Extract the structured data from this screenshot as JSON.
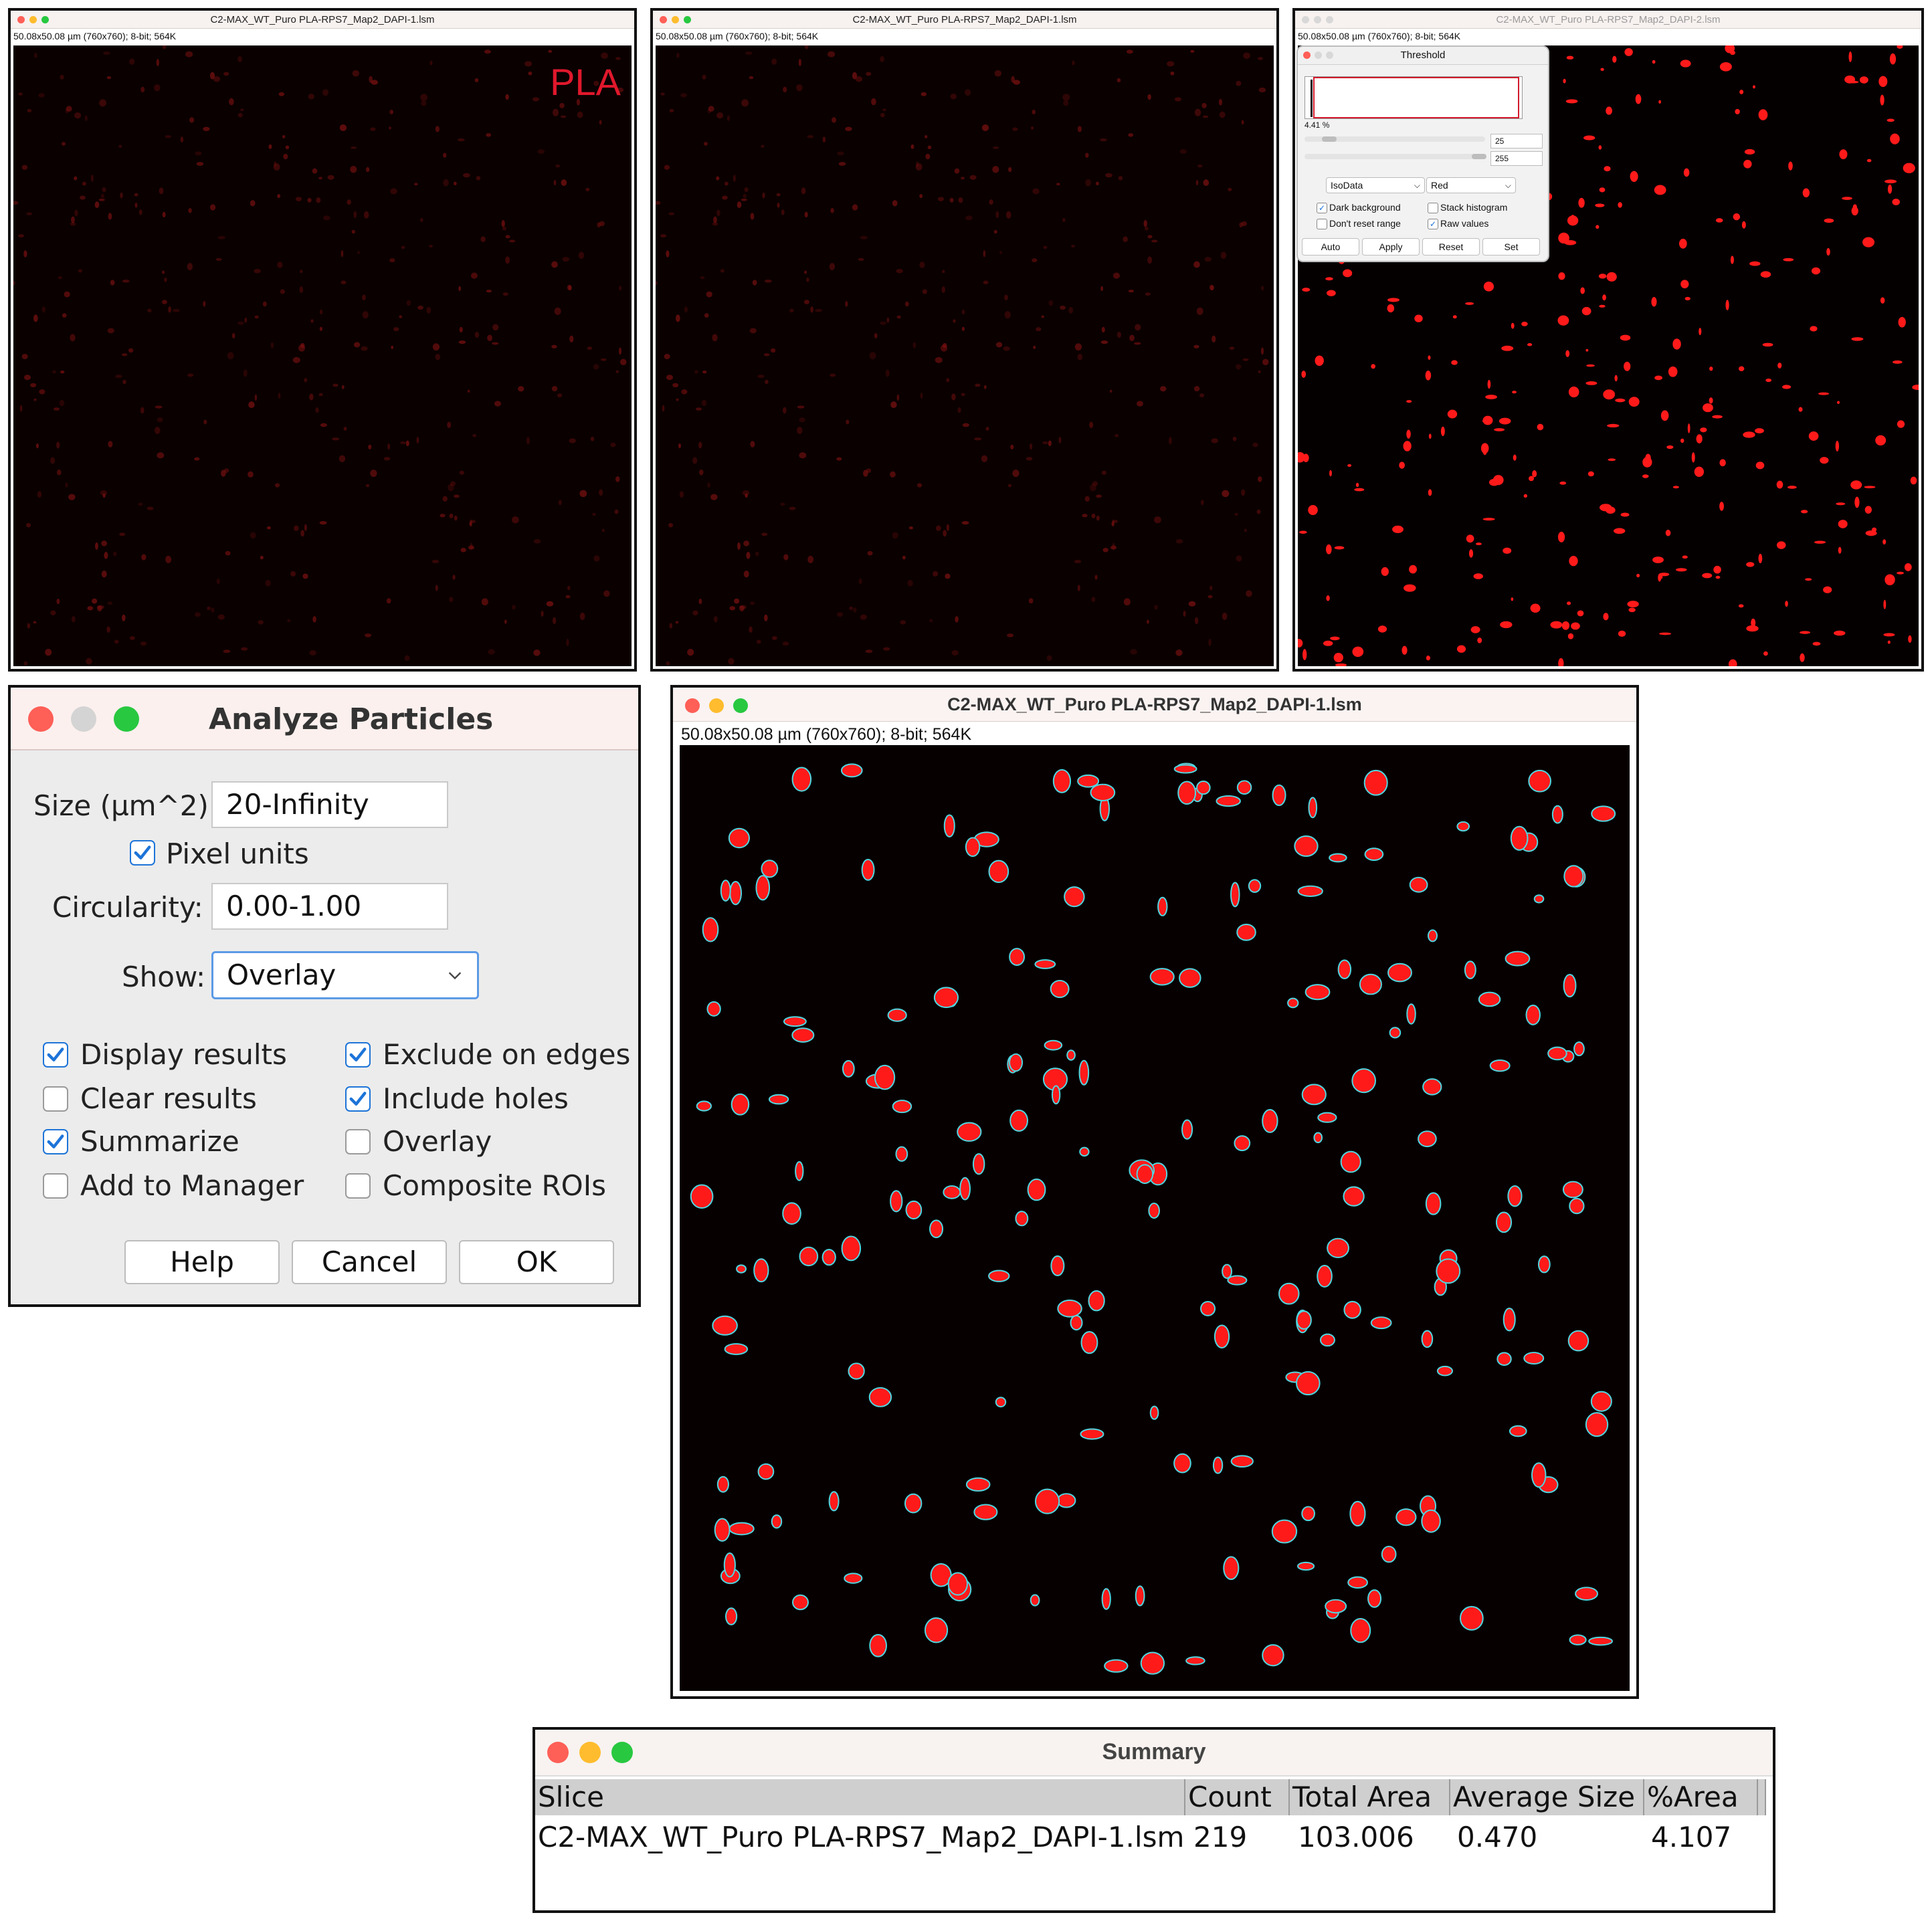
{
  "windows": {
    "image1": {
      "title": "C2-MAX_WT_Puro PLA-RPS7_Map2_DAPI-1.lsm",
      "info": "50.08x50.08 µm (760x760); 8-bit; 564K",
      "label": "PLA"
    },
    "image2": {
      "title": "C2-MAX_WT_Puro PLA-RPS7_Map2_DAPI-1.lsm",
      "info": "50.08x50.08 µm (760x760); 8-bit; 564K"
    },
    "image3": {
      "title": "C2-MAX_WT_Puro PLA-RPS7_Map2_DAPI-2.lsm",
      "info": "50.08x50.08 µm (760x760); 8-bit; 564K"
    },
    "overlay_image": {
      "title": "C2-MAX_WT_Puro PLA-RPS7_Map2_DAPI-1.lsm",
      "info": "50.08x50.08 µm (760x760); 8-bit; 564K"
    }
  },
  "threshold": {
    "title": "Threshold",
    "percent": "4.41 %",
    "min_value": "25",
    "max_value": "255",
    "method": "IsoData",
    "mode": "Red",
    "checkboxes": [
      {
        "label": "Dark background",
        "checked": true
      },
      {
        "label": "Stack histogram",
        "checked": false
      },
      {
        "label": "Don't reset range",
        "checked": false
      },
      {
        "label": "Raw values",
        "checked": true
      }
    ],
    "buttons": [
      "Auto",
      "Apply",
      "Reset",
      "Set"
    ]
  },
  "analyze": {
    "title": "Analyze Particles",
    "size_label": "Size (µm^2):",
    "size_value": "20-Infinity",
    "pixel_units_label": "Pixel units",
    "pixel_units_checked": true,
    "circularity_label": "Circularity:",
    "circularity_value": "0.00-1.00",
    "show_label": "Show:",
    "show_value": "Overlay",
    "options": [
      {
        "label": "Display results",
        "checked": true
      },
      {
        "label": "Exclude on edges",
        "checked": true
      },
      {
        "label": "Clear results",
        "checked": false
      },
      {
        "label": "Include holes",
        "checked": true
      },
      {
        "label": "Summarize",
        "checked": true
      },
      {
        "label": "Overlay",
        "checked": false
      },
      {
        "label": "Add to Manager",
        "checked": false
      },
      {
        "label": "Composite ROIs",
        "checked": false
      }
    ],
    "buttons": {
      "help": "Help",
      "cancel": "Cancel",
      "ok": "OK"
    }
  },
  "summary": {
    "title": "Summary",
    "columns": [
      "Slice",
      "Count",
      "Total Area",
      "Average Size",
      "%Area"
    ],
    "row": [
      "C2-MAX_WT_Puro PLA-RPS7_Map2_DAPI-1.lsm",
      "219",
      "103.006",
      "0.470",
      "4.107"
    ]
  },
  "colors": {
    "close": "#fe5f57",
    "minimize": "#febc2e",
    "zoom": "#28c840",
    "particle": "#ff1a1a",
    "outline": "#4fd6e0",
    "accent": "#1d74d8"
  }
}
